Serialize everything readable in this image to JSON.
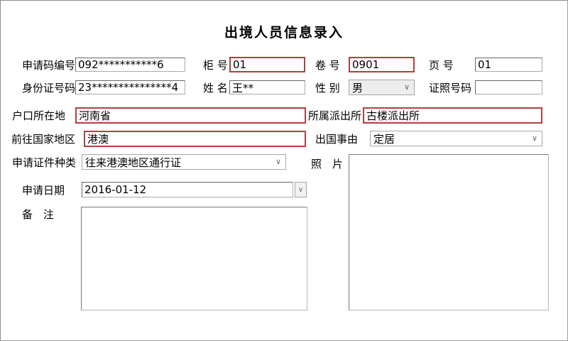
{
  "title": "出境人员信息录入",
  "colors": {
    "required_border": "#b04040",
    "input_border": "#ababab",
    "window_border": "#a0a0a0"
  },
  "icons": {
    "combo_arrow": "∨"
  },
  "form": {
    "application_code": {
      "label": "申请码编号",
      "value": "092***********6"
    },
    "counter_no": {
      "label": "柜 号",
      "value": "01"
    },
    "volume_no": {
      "label": "卷 号",
      "value": "0901"
    },
    "page_no": {
      "label": "页 号",
      "value": "01"
    },
    "id_number": {
      "label": "身份证号码",
      "value": "23***************4"
    },
    "name": {
      "label": "姓 名",
      "value": "王**"
    },
    "gender": {
      "label": "性 别",
      "value": "男"
    },
    "passport_no": {
      "label": "证照号码",
      "value": ""
    },
    "household_location": {
      "label": "户口所在地",
      "value": "河南省"
    },
    "police_station": {
      "label": "所属派出所",
      "value": "古楼派出所"
    },
    "destination": {
      "label": "前往国家地区",
      "value": "港澳"
    },
    "exit_reason": {
      "label": "出国事由",
      "value": "定居"
    },
    "certificate_type": {
      "label": "申请证件种类",
      "value": "往来港澳地区通行证"
    },
    "photo": {
      "label": "照　片"
    },
    "application_date": {
      "label": "申请日期",
      "value": "2016-01-12"
    },
    "remarks": {
      "label": "备　注",
      "value": ""
    }
  }
}
